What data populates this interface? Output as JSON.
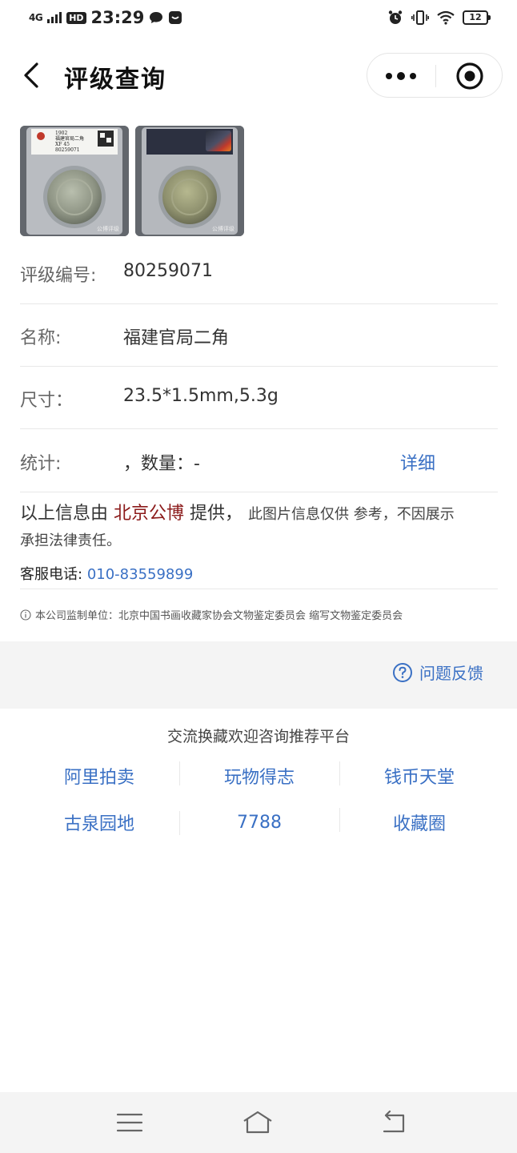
{
  "status_bar": {
    "signal": "4G",
    "hd": "HD",
    "time": "23:29",
    "battery": "12"
  },
  "nav": {
    "title": "评级查询"
  },
  "info": {
    "grade_number_label": "评级编号:",
    "grade_number_value": "80259071",
    "name_label": "名称:",
    "name_value": "福建官局二角",
    "size_label": "尺寸：",
    "size_value": "23.5*1.5mm,5.3g",
    "stats_label": "统计:",
    "stats_value": "，数量：-",
    "detail_link": "详细"
  },
  "thumbs": [
    {
      "watermark": "公博评级",
      "slab_year": "1902",
      "slab_name": "福建官局二角",
      "slab_grade": "XF 45",
      "slab_number": "80259071"
    },
    {
      "watermark": "公博评级"
    }
  ],
  "disclaimer": {
    "prefix": "以上信息由",
    "org": "北京公博",
    "provided": "提供，",
    "note1": "此图片信息仅供 参考，不因展示",
    "note2": "承担法律责任。"
  },
  "contact": {
    "label": "客服电话:",
    "phone": "010-83559899"
  },
  "supervise_text": "本公司监制单位：北京中国书画收藏家协会文物鉴定委员会 缩写文物鉴定委员会",
  "feedback_label": "问题反馈",
  "platforms": {
    "title": "交流换藏欢迎咨询推荐平台",
    "row1": [
      "阿里拍卖",
      "玩物得志",
      "钱币天堂"
    ],
    "row2": [
      "古泉园地",
      "7788",
      "收藏圈"
    ]
  },
  "colors": {
    "link": "#3a70c4",
    "org": "#8b1a1a"
  }
}
